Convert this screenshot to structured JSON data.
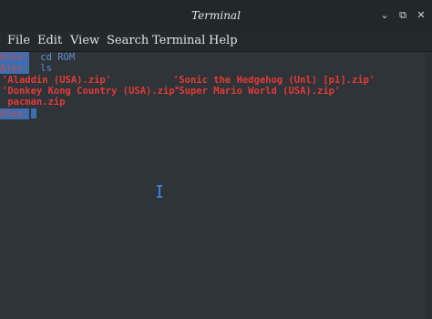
{
  "window": {
    "title": "Terminal"
  },
  "titlebar_buttons": [
    {
      "icon": "minimize-icon",
      "glyph": "⌄"
    },
    {
      "icon": "restore-icon",
      "glyph": "⧉"
    },
    {
      "icon": "close-icon",
      "glyph": "✕"
    }
  ],
  "menu": [
    "File",
    "Edit",
    "View",
    "Search",
    "Terminal",
    "Help"
  ],
  "terminal": {
    "prompt": "Alex:",
    "commands": [
      "cd ROM",
      "ls"
    ],
    "files_row1": [
      "'Aladdin (USA).zip'",
      "'Sonic the Hedgehog (Unl) [p1].zip'"
    ],
    "files_row2": [
      "'Donkey Kong Country (USA).zip'",
      "'Super Mario World (USA).zip'"
    ],
    "files_row3": [
      " pacman.zip"
    ]
  },
  "colors": {
    "prompt_bg": "#3b6fb3",
    "prompt_fg": "#c84a4a",
    "command": "#5b8fd3",
    "file": "#e33a3a"
  }
}
